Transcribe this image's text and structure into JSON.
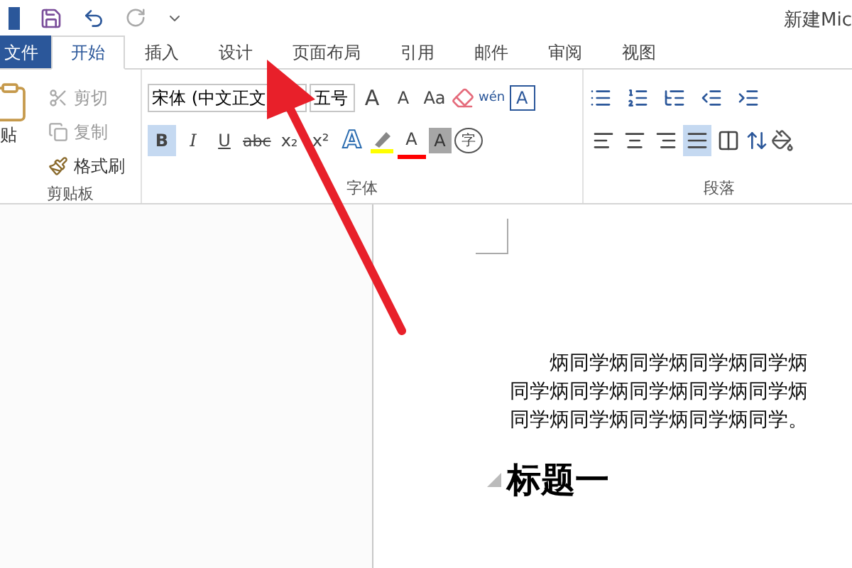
{
  "title_bar": {
    "title": "新建Mic"
  },
  "tabs": [
    {
      "label": "文件",
      "kind": "file",
      "selected": false
    },
    {
      "label": "开始",
      "kind": "tab",
      "selected": true
    },
    {
      "label": "插入",
      "kind": "tab",
      "selected": false
    },
    {
      "label": "设计",
      "kind": "tab",
      "selected": false
    },
    {
      "label": "页面布局",
      "kind": "tab",
      "selected": false
    },
    {
      "label": "引用",
      "kind": "tab",
      "selected": false
    },
    {
      "label": "邮件",
      "kind": "tab",
      "selected": false
    },
    {
      "label": "审阅",
      "kind": "tab",
      "selected": false
    },
    {
      "label": "视图",
      "kind": "tab",
      "selected": false
    }
  ],
  "clipboard": {
    "paste": "贴",
    "actions": [
      {
        "label": "剪切",
        "kind": "cut",
        "disabled": true
      },
      {
        "label": "复制",
        "kind": "copy",
        "disabled": true
      },
      {
        "label": "格式刷",
        "kind": "painter",
        "disabled": false
      }
    ],
    "group_label": "剪贴板"
  },
  "font": {
    "font_name": "宋体 (中文正文",
    "font_size": "五号",
    "top_buttons": [
      {
        "label": "A",
        "kind": "grow"
      },
      {
        "label": "A",
        "kind": "shrink"
      },
      {
        "label": "Aa",
        "kind": "case"
      },
      {
        "kind": "eraser"
      },
      {
        "label": "wén",
        "kind": "pinyin"
      },
      {
        "label": "A",
        "kind": "boxed"
      }
    ],
    "format_buttons": [
      {
        "label": "B",
        "kind": "bold",
        "selected": true
      },
      {
        "label": "I",
        "kind": "italic",
        "selected": false
      },
      {
        "label": "U",
        "kind": "underline",
        "selected": false
      },
      {
        "label": "abc",
        "kind": "strike",
        "selected": false
      },
      {
        "label": "x₂",
        "kind": "sub",
        "selected": false
      },
      {
        "label": "x²",
        "kind": "sup",
        "selected": false
      }
    ],
    "effect_buttons": [
      {
        "label": "A",
        "kind": "effect"
      },
      {
        "kind": "highlight",
        "color": "#ffff00"
      },
      {
        "label": "A",
        "kind": "fontcolor",
        "color": "#ff0000"
      },
      {
        "label": "A",
        "kind": "shaded"
      },
      {
        "label": "字",
        "kind": "circled"
      }
    ],
    "group_label": "字体"
  },
  "paragraph": {
    "align_buttons": [
      {
        "kind": "left",
        "selected": false
      },
      {
        "kind": "center",
        "selected": false
      },
      {
        "kind": "right",
        "selected": false
      },
      {
        "kind": "justify",
        "selected": true
      },
      {
        "kind": "distributed",
        "selected": false
      }
    ],
    "group_label": "段落"
  },
  "document": {
    "lines": [
      "炳同学炳同学炳同学炳同学炳",
      "同学炳同学炳同学炳同学炳同学炳",
      "同学炳同学炳同学炳同学炳同学。"
    ],
    "heading": "标题一"
  }
}
